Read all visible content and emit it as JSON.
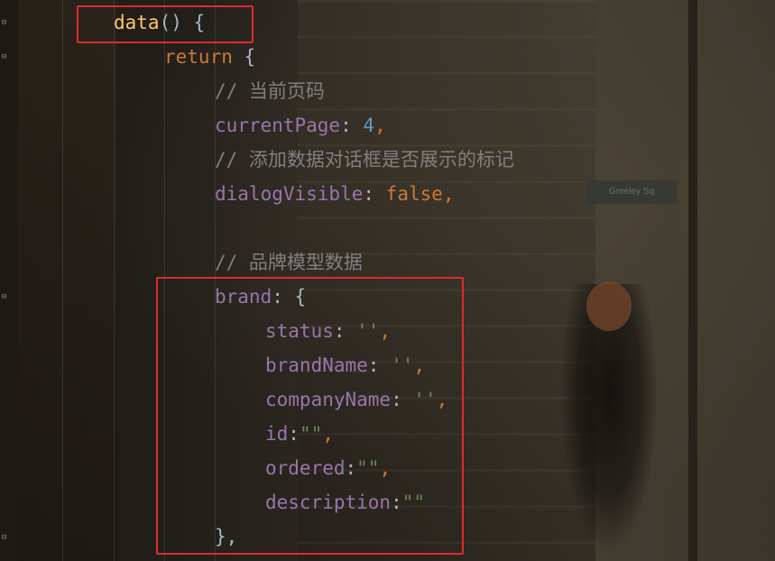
{
  "code_lines": {
    "l1": {
      "fn": "data",
      "paren": "()",
      "brace": " {"
    },
    "l2": {
      "kw": "return",
      "brace": " {"
    },
    "l3": {
      "comment": "// 当前页码"
    },
    "l4": {
      "prop": "currentPage",
      "colon": ": ",
      "num": "4",
      "comma": ","
    },
    "l5": {
      "comment": "// 添加数据对话框是否展示的标记"
    },
    "l6": {
      "prop": "dialogVisible",
      "colon": ": ",
      "kw": "false",
      "comma": ","
    },
    "l7": {
      "comment": "// 品牌模型数据"
    },
    "l8": {
      "prop": "brand",
      "colon": ": ",
      "brace": "{"
    },
    "l9": {
      "prop": "status",
      "colon": ": ",
      "str": "''",
      "comma": ","
    },
    "l10": {
      "prop": "brandName",
      "colon": ": ",
      "str": "''",
      "comma": ","
    },
    "l11": {
      "prop": "companyName",
      "colon": ": ",
      "str": "''",
      "comma": ","
    },
    "l12": {
      "prop": "id",
      "colon": ":",
      "str": "\"\"",
      "comma": ","
    },
    "l13": {
      "prop": "ordered",
      "colon": ":",
      "str": "\"\"",
      "comma": ","
    },
    "l14": {
      "prop": "description",
      "colon": ":",
      "str": "\"\""
    },
    "l15": {
      "brace": "},",
      "comma": ""
    }
  },
  "wallpaper": {
    "street_sign": "Greeley Sq"
  },
  "colors": {
    "keyword": "#cc7832",
    "function": "#ffc66d",
    "property": "#9876aa",
    "number": "#6897bb",
    "string": "#6a8759",
    "comment": "#808080",
    "highlight_box": "#e02a2a"
  },
  "icons": {
    "fold_marker": "fold-marker-icon"
  }
}
